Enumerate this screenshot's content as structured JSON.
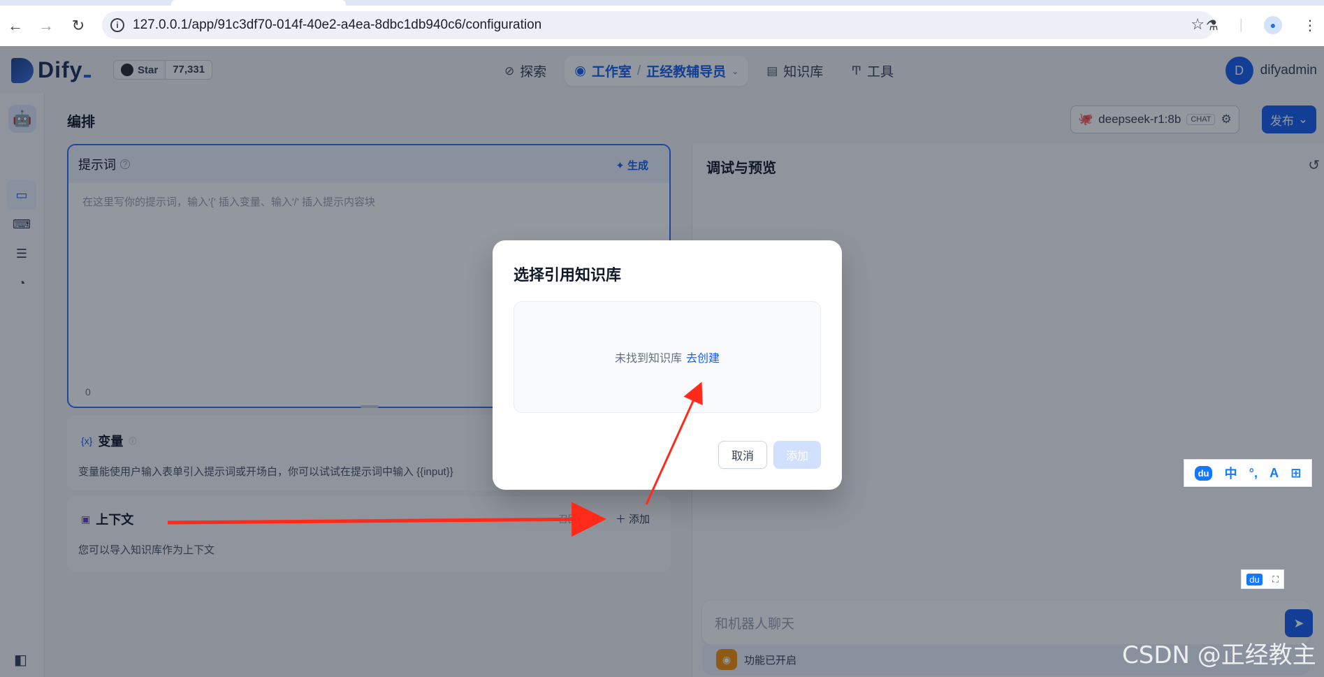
{
  "browser": {
    "url": "127.0.0.1/app/91c3df70-014f-40e2-a4ea-8dbc1db940c6/configuration",
    "back_icon": "arrow-left-icon",
    "forward_icon": "arrow-right-icon",
    "reload_icon": "reload-icon",
    "star_icon": "star-icon"
  },
  "header": {
    "logo": "Dify",
    "github_star_label": "Star",
    "github_star_count": "77,331",
    "nav": {
      "explore": "探索",
      "studio": "工作室",
      "separator": "/",
      "current_app": "正经教辅导员",
      "knowledge": "知识库",
      "tools": "工具"
    },
    "user": {
      "initial": "D",
      "name": "difyadmin"
    }
  },
  "page": {
    "title": "编排",
    "model": {
      "name": "deepseek-r1:8b",
      "badge": "CHAT"
    },
    "publish_label": "发布"
  },
  "prompt": {
    "title": "提示词",
    "generate_label": "生成",
    "placeholder": "在这里写你的提示词，输入'{' 插入变量、输入'/' 插入提示内容块",
    "char_count": "0"
  },
  "variables": {
    "title": "变量",
    "icon_text": "{x}",
    "description": "变量能使用户输入表单引入提示词或开场白，你可以试试在提示词中输入 {{input}}"
  },
  "context": {
    "title": "上下文",
    "recall_label": "召回设置",
    "add_label": "添加",
    "description": "您可以导入知识库作为上下文"
  },
  "debug": {
    "title": "调试与预览",
    "chat_placeholder": "和机器人聊天",
    "feature_label": "功能已开启"
  },
  "modal": {
    "title": "选择引用知识库",
    "empty_text": "未找到知识库",
    "create_link": "去创建",
    "cancel_label": "取消",
    "add_label": "添加"
  },
  "ime": {
    "logo": "du",
    "mode": "中",
    "punct": "°,",
    "skin": "A",
    "grid": "⊞"
  },
  "watermark": "CSDN @正经教主",
  "colors": {
    "accent": "#155eef",
    "arrow": "#ff2a1a"
  }
}
